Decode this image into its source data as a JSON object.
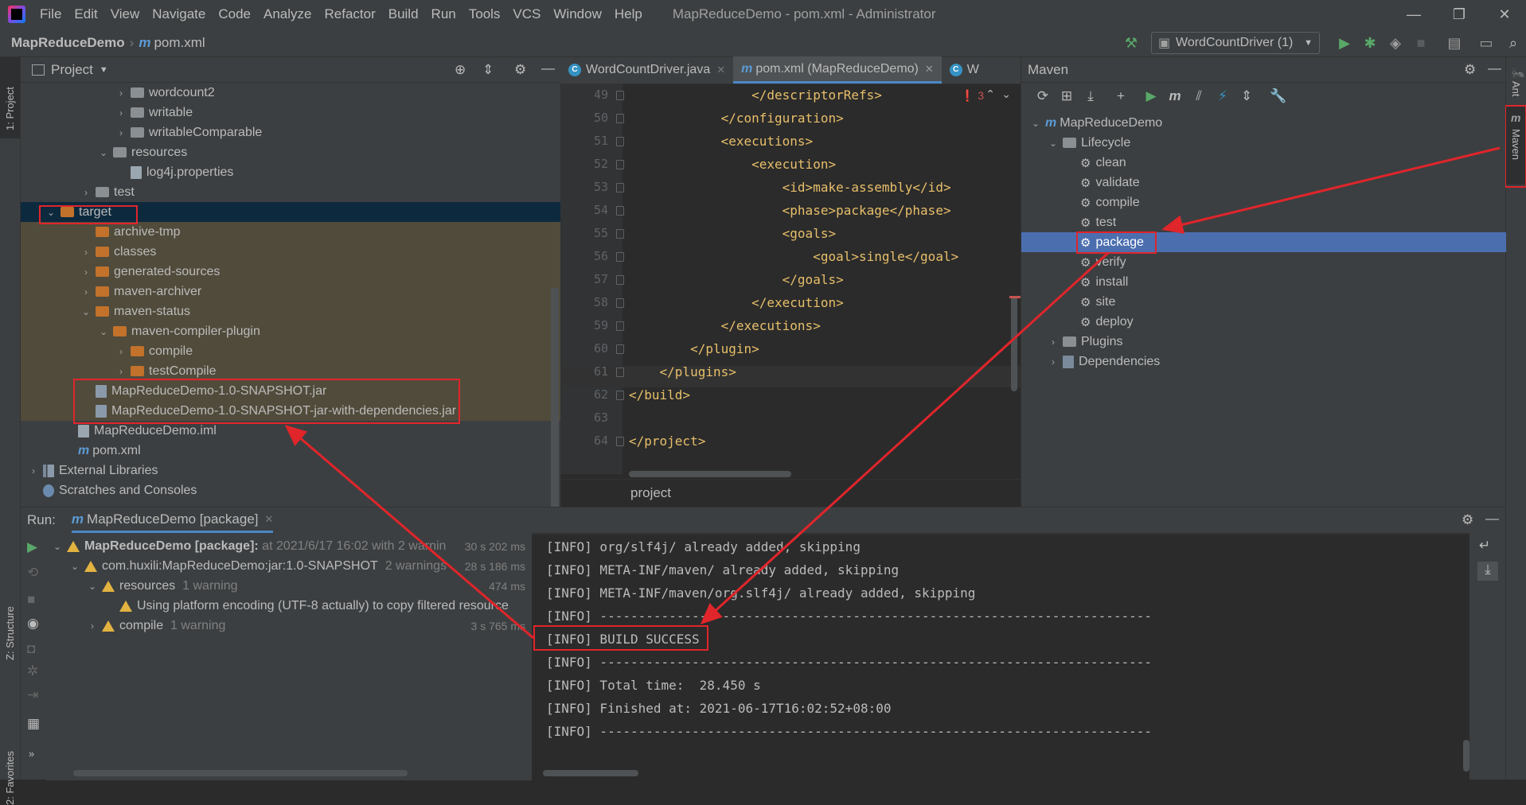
{
  "menubar": {
    "items": [
      "File",
      "Edit",
      "View",
      "Navigate",
      "Code",
      "Analyze",
      "Refactor",
      "Build",
      "Run",
      "Tools",
      "VCS",
      "Window",
      "Help"
    ],
    "window_title": "MapReduceDemo - pom.xml - Administrator"
  },
  "navbar": {
    "project": "MapReduceDemo",
    "file": "pom.xml",
    "run_config": "WordCountDriver (1)"
  },
  "left_stripe": {
    "project_tab": "1: Project",
    "structure_tab": "Z: Structure",
    "favorites_tab": "2: Favorites"
  },
  "right_stripe": {
    "ant_tab": "Ant",
    "maven_tab": "Maven"
  },
  "project_panel": {
    "title": "Project",
    "tree": [
      {
        "label": "wordcount2",
        "indent": 5,
        "arrow": "›",
        "icon": "folder-gray"
      },
      {
        "label": "writable",
        "indent": 5,
        "arrow": "›",
        "icon": "folder-gray"
      },
      {
        "label": "writableComparable",
        "indent": 5,
        "arrow": "›",
        "icon": "folder-gray"
      },
      {
        "label": "resources",
        "indent": 4,
        "arrow": "⌄",
        "icon": "folder-gray"
      },
      {
        "label": "log4j.properties",
        "indent": 5,
        "arrow": "",
        "icon": "file-props"
      },
      {
        "label": "test",
        "indent": 3,
        "arrow": "›",
        "icon": "folder-gray"
      },
      {
        "label": "target",
        "indent": 1,
        "arrow": "⌄",
        "icon": "folder-orange"
      },
      {
        "label": "archive-tmp",
        "indent": 3,
        "arrow": "",
        "icon": "folder-orange"
      },
      {
        "label": "classes",
        "indent": 3,
        "arrow": "›",
        "icon": "folder-orange"
      },
      {
        "label": "generated-sources",
        "indent": 3,
        "arrow": "›",
        "icon": "folder-orange"
      },
      {
        "label": "maven-archiver",
        "indent": 3,
        "arrow": "›",
        "icon": "folder-orange"
      },
      {
        "label": "maven-status",
        "indent": 3,
        "arrow": "⌄",
        "icon": "folder-orange"
      },
      {
        "label": "maven-compiler-plugin",
        "indent": 4,
        "arrow": "⌄",
        "icon": "folder-orange"
      },
      {
        "label": "compile",
        "indent": 5,
        "arrow": "›",
        "icon": "folder-orange"
      },
      {
        "label": "testCompile",
        "indent": 5,
        "arrow": "›",
        "icon": "folder-orange"
      },
      {
        "label": "MapReduceDemo-1.0-SNAPSHOT.jar",
        "indent": 3,
        "arrow": "",
        "icon": "file-jar"
      },
      {
        "label": "MapReduceDemo-1.0-SNAPSHOT-jar-with-dependencies.jar",
        "indent": 3,
        "arrow": "",
        "icon": "file-jar"
      },
      {
        "label": "MapReduceDemo.iml",
        "indent": 2,
        "arrow": "",
        "icon": "file-iml"
      },
      {
        "label": "pom.xml",
        "indent": 2,
        "arrow": "",
        "icon": "file-maven"
      },
      {
        "label": "External Libraries",
        "indent": 0,
        "arrow": "›",
        "icon": "libraries"
      },
      {
        "label": "Scratches and Consoles",
        "indent": 0,
        "arrow": "",
        "icon": "scratches"
      }
    ]
  },
  "editor": {
    "tabs": [
      {
        "label": "WordCountDriver.java",
        "active": false
      },
      {
        "label": "pom.xml (MapReduceDemo)",
        "active": true
      },
      {
        "label": "W",
        "active": false
      }
    ],
    "error_count": "3",
    "lines": [
      {
        "num": "49",
        "text": "                </descriptorRefs>"
      },
      {
        "num": "50",
        "text": "            </configuration>"
      },
      {
        "num": "51",
        "text": "            <executions>"
      },
      {
        "num": "52",
        "text": "                <execution>"
      },
      {
        "num": "53",
        "text": "                    <id>make-assembly</id>"
      },
      {
        "num": "54",
        "text": "                    <phase>package</phase>"
      },
      {
        "num": "55",
        "text": "                    <goals>"
      },
      {
        "num": "56",
        "text": "                        <goal>single</goal>"
      },
      {
        "num": "57",
        "text": "                    </goals>"
      },
      {
        "num": "58",
        "text": "                </execution>"
      },
      {
        "num": "59",
        "text": "            </executions>"
      },
      {
        "num": "60",
        "text": "        </plugin>"
      },
      {
        "num": "61",
        "text": "    </plugins>"
      },
      {
        "num": "62",
        "text": "</build>"
      },
      {
        "num": "63",
        "text": ""
      },
      {
        "num": "64",
        "text": "</project>"
      }
    ],
    "breadcrumb": "project"
  },
  "maven_panel": {
    "title": "Maven",
    "root": "MapReduceDemo",
    "lifecycle_label": "Lifecycle",
    "phases": [
      "clean",
      "validate",
      "compile",
      "test",
      "package",
      "verify",
      "install",
      "site",
      "deploy"
    ],
    "selected_phase": "package",
    "plugins_label": "Plugins",
    "dependencies_label": "Dependencies"
  },
  "run_panel": {
    "label": "Run:",
    "tab": "MapReduceDemo [package]",
    "tree": [
      {
        "label": "MapReduceDemo [package]:",
        "detail": " at 2021/6/17 16:02 with 2 warnin",
        "time": "30 s 202 ms",
        "indent": 0,
        "arrow": "⌄",
        "bold": true
      },
      {
        "label": "com.huxili:MapReduceDemo:jar:1.0-SNAPSHOT",
        "detail": "  2 warnings",
        "time": "28 s 186 ms",
        "indent": 1,
        "arrow": "⌄",
        "bold": false
      },
      {
        "label": "resources",
        "detail": "  1 warning",
        "time": "474 ms",
        "indent": 2,
        "arrow": "⌄",
        "bold": false
      },
      {
        "label": "Using platform encoding (UTF-8 actually) to copy filtered resource",
        "detail": "",
        "time": "",
        "indent": 3,
        "arrow": "",
        "bold": false
      },
      {
        "label": "compile",
        "detail": "  1 warning",
        "time": "3 s 765 ms",
        "indent": 2,
        "arrow": "›",
        "bold": false
      }
    ],
    "console": [
      "[INFO] org/slf4j/ already added, skipping",
      "[INFO] META-INF/maven/ already added, skipping",
      "[INFO] META-INF/maven/org.slf4j/ already added, skipping",
      "[INFO] ------------------------------------------------------------------------",
      "[INFO] BUILD SUCCESS",
      "[INFO] ------------------------------------------------------------------------",
      "[INFO] Total time:  28.450 s",
      "[INFO] Finished at: 2021-06-17T16:02:52+08:00",
      "[INFO] ------------------------------------------------------------------------"
    ]
  },
  "colors": {
    "annotation": "#e0252b",
    "selection": "#4b6eaf",
    "target_row": "#0d293e"
  }
}
